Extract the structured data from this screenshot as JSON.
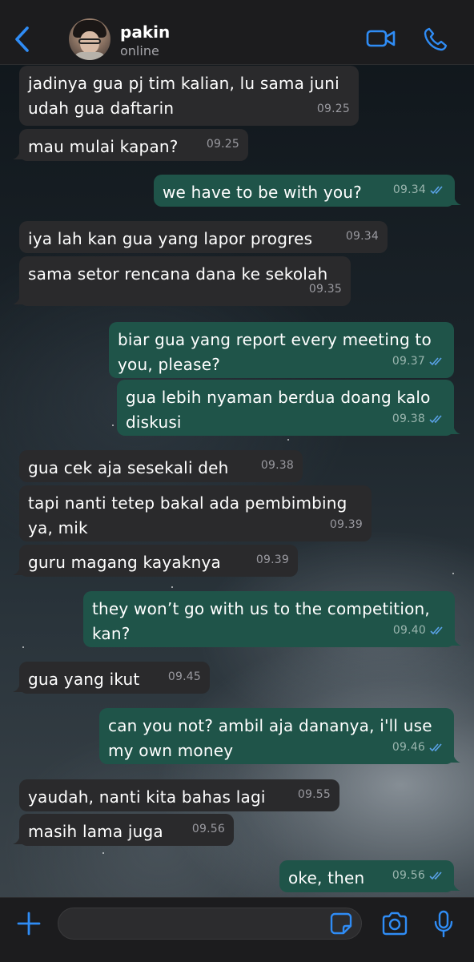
{
  "header": {
    "contact_name": "pakin",
    "status": "online",
    "icons": [
      "chevron-left-icon",
      "video-camera-icon",
      "phone-icon"
    ],
    "accent_color": "#2f8cf5"
  },
  "messages": [
    {
      "direction": "in",
      "lines": [
        "jadinya gua pj tim kalian, lu sama juni",
        "udah gua daftarin"
      ],
      "time": "09.25"
    },
    {
      "direction": "in",
      "lines": [
        "mau mulai kapan?"
      ],
      "time": "09.25"
    },
    {
      "direction": "out",
      "lines": [
        "we have to be with you?"
      ],
      "time": "09.34",
      "read": true
    },
    {
      "direction": "in",
      "lines": [
        "iya lah kan gua yang lapor progres"
      ],
      "time": "09.34"
    },
    {
      "direction": "in",
      "lines": [
        "sama setor rencana dana ke sekolah"
      ],
      "time": "09.35"
    },
    {
      "direction": "out",
      "lines": [
        "biar gua yang report every meeting to",
        "you, please?"
      ],
      "time": "09.37",
      "read": true
    },
    {
      "direction": "out",
      "lines": [
        "gua lebih nyaman berdua doang kalo",
        "diskusi"
      ],
      "time": "09.38",
      "read": true
    },
    {
      "direction": "in",
      "lines": [
        "gua cek aja sesekali deh"
      ],
      "time": "09.38"
    },
    {
      "direction": "in",
      "lines": [
        "tapi nanti tetep bakal ada pembimbing",
        "ya, mik"
      ],
      "time": "09.39"
    },
    {
      "direction": "in",
      "lines": [
        "guru magang kayaknya"
      ],
      "time": "09.39"
    },
    {
      "direction": "out",
      "lines": [
        "they won’t go with us to the competition,",
        "kan?"
      ],
      "time": "09.40",
      "read": true
    },
    {
      "direction": "in",
      "lines": [
        "gua yang ikut"
      ],
      "time": "09.45"
    },
    {
      "direction": "out",
      "lines": [
        "can you not? ambil aja dananya, i'll use",
        "my own money"
      ],
      "time": "09.46",
      "read": true
    },
    {
      "direction": "in",
      "lines": [
        "yaudah, nanti kita bahas lagi"
      ],
      "time": "09.55"
    },
    {
      "direction": "in",
      "lines": [
        "masih lama juga"
      ],
      "time": "09.56"
    },
    {
      "direction": "out",
      "lines": [
        "oke, then"
      ],
      "time": "09.56",
      "read": true
    }
  ],
  "input_bar": {
    "message_value": "",
    "icons": [
      "plus-icon",
      "sticker-icon",
      "camera-icon",
      "microphone-icon"
    ]
  },
  "colors": {
    "incoming_bubble": "#2a2a2c",
    "outgoing_bubble": "#1f5449",
    "read_ticks": "#5aa2e8"
  }
}
